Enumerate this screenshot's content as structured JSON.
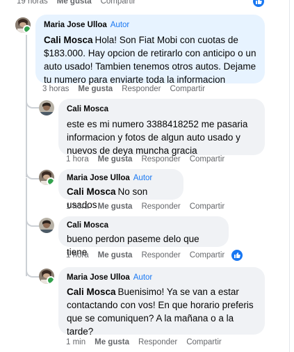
{
  "top_bar": {
    "time": "19 horas",
    "like": "Me gusta",
    "share": "Compartir"
  },
  "comments": [
    {
      "author": "Maria Jose Ulloa",
      "badge": "Autor",
      "mention": "Cali Mosca",
      "text_lines": [
        "Hola! Son Fiat Mobi con cuotas de",
        "$183.000. Hay opcion de retirarlo con anticipo o un",
        "auto usado! Tambien tenemos otros autos. Dejame",
        "tu numero para enviarte toda la informacion"
      ],
      "time": "3 horas",
      "like": "Me gusta",
      "reply": "Responder",
      "share": "Compartir"
    },
    {
      "author": "Cali Mosca",
      "text_lines": [
        "este es mi numero 3388418252 me pasaria",
        "informacion y fotos de algun auto usado y",
        "nuevos de deya muncha gracia"
      ],
      "time": "1 hora",
      "like": "Me gusta",
      "reply": "Responder",
      "share": "Compartir"
    },
    {
      "author": "Maria Jose Ulloa",
      "badge": "Autor",
      "mention": "Cali Mosca",
      "text": "No son usados",
      "time": "1 hora",
      "like": "Me gusta",
      "reply": "Responder",
      "share": "Compartir"
    },
    {
      "author": "Cali Mosca",
      "text": "bueno perdon paseme delo que tiene",
      "time": "1 hora",
      "like": "Me gusta",
      "reply": "Responder",
      "share": "Compartir"
    },
    {
      "author": "Maria Jose Ulloa",
      "badge": "Autor",
      "mention": "Cali Mosca",
      "text_lines": [
        "Buenisimo! Ya se van a estar",
        "contactando con vos! En que horario preferis",
        "que se comuniquen? A la mañana o a la",
        "tarde?"
      ],
      "time": "1 min",
      "like": "Me gusta",
      "reply": "Responder",
      "share": "Compartir"
    }
  ],
  "colors": {
    "author_badge": "#1877f2",
    "highlight_bubble": "#e7f3ff",
    "bubble": "#f0f2f5",
    "online": "#31a24c",
    "like_reaction": "#1877f2"
  }
}
